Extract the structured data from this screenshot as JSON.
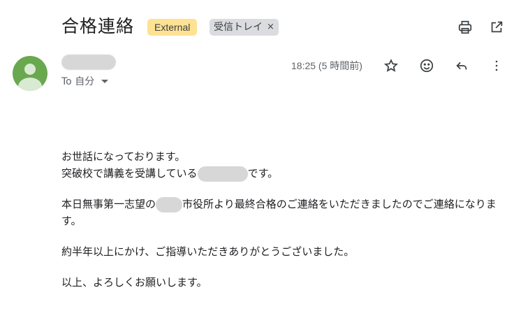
{
  "email": {
    "subject": "合格連絡",
    "labels": {
      "external": "External",
      "inbox": "受信トレイ",
      "inbox_remove": "×"
    },
    "to_line": "To 自分",
    "timestamp": "18:25 (5 時間前)",
    "body": {
      "line1": "お世話になっております。",
      "line2_a": "突破校で講義を受講している",
      "line2_b": "です。",
      "para2_a": "本日無事第一志望の",
      "para2_b": "市役所より最終合格のご連絡をいただきましたのでご連絡になります。",
      "para3": "約半年以上にかけ、ご指導いただきありがとうございました。",
      "para4": "以上、よろしくお願いします。"
    }
  },
  "icons": {
    "print": "print-icon",
    "open_new_window": "open-in-new-icon",
    "star": "star-icon",
    "emoji": "emoji-icon",
    "reply": "reply-icon",
    "more": "more-vert-icon",
    "avatar": "avatar-icon"
  },
  "colors": {
    "external_chip": "#fde293",
    "inbox_chip": "#dadce0",
    "avatar_bg": "#6aa84f"
  }
}
